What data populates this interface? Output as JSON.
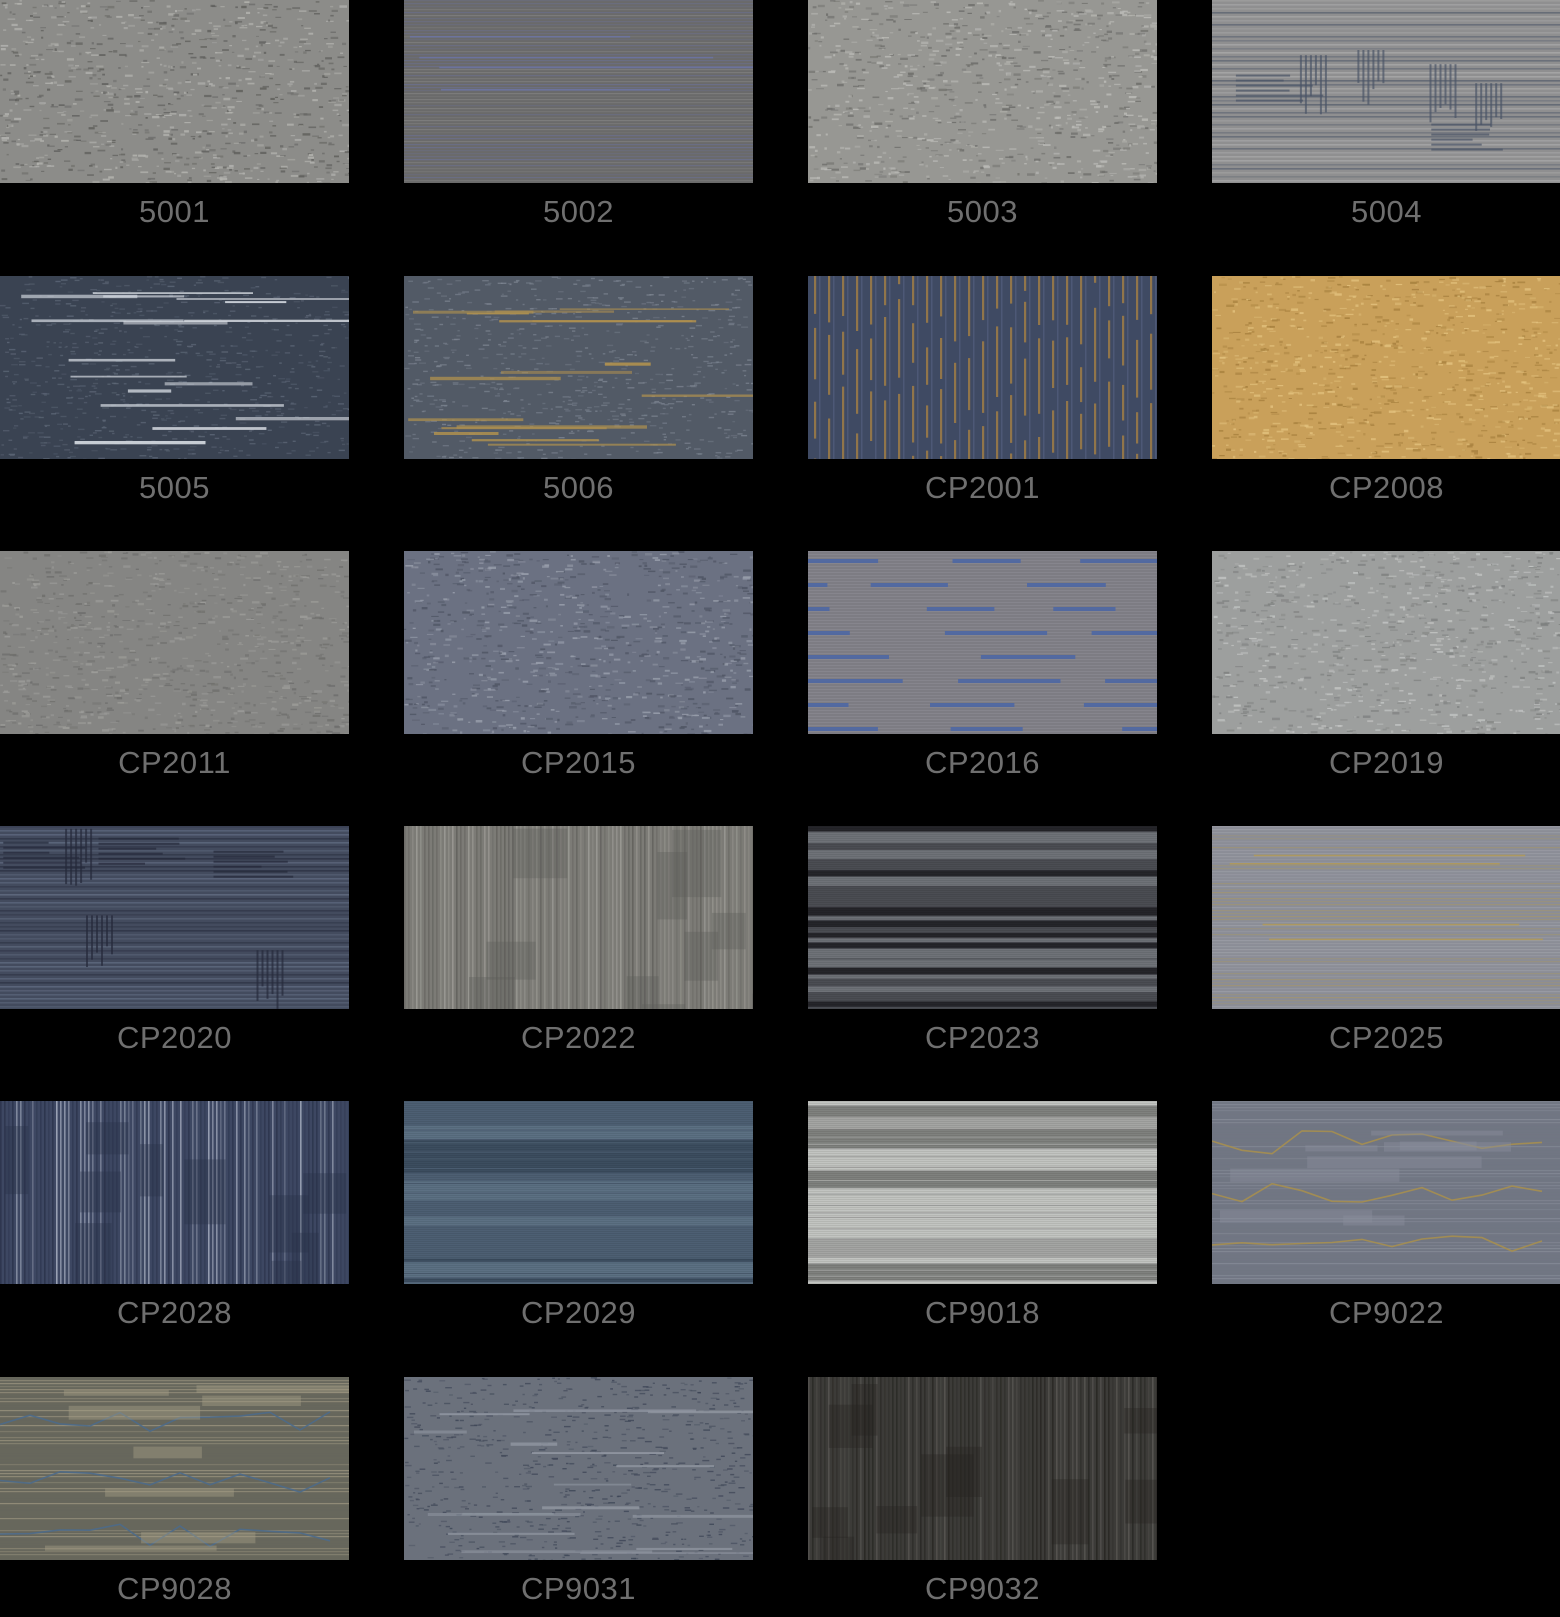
{
  "swatches": [
    {
      "code": "5001",
      "pattern": "noise",
      "base": "#8c8c89",
      "accent": "#b4b4b0",
      "accent2": "#5f5f5c"
    },
    {
      "code": "5002",
      "pattern": "hlines",
      "base": "#6a6a6a",
      "accent": "#8e8e8e",
      "accent2": "#6c74a4"
    },
    {
      "code": "5003",
      "pattern": "noise",
      "base": "#979793",
      "accent": "#bcbcb8",
      "accent2": "#6c6c69"
    },
    {
      "code": "5004",
      "pattern": "blocks",
      "base": "#8f8f90",
      "accent": "#b3b3b3",
      "accent2": "#4a5466"
    },
    {
      "code": "5005",
      "pattern": "streaks",
      "base": "#3a4352",
      "accent": "#d4d9e0",
      "accent2": "#5e6878"
    },
    {
      "code": "5006",
      "pattern": "streaks",
      "base": "#525a66",
      "accent": "#b0914f",
      "accent2": "#7d8592"
    },
    {
      "code": "CP2001",
      "pattern": "vdash",
      "base": "#3f4a63",
      "accent": "#a07c45",
      "accent2": "#566383"
    },
    {
      "code": "CP2008",
      "pattern": "noise",
      "base": "#c9a05a",
      "accent": "#e3c27e",
      "accent2": "#a67f3d"
    },
    {
      "code": "CP2011",
      "pattern": "noise",
      "base": "#858583",
      "accent": "#9d9d9a",
      "accent2": "#6e6e6c"
    },
    {
      "code": "CP2015",
      "pattern": "noise",
      "base": "#6b7182",
      "accent": "#9aa0ad",
      "accent2": "#4f5564"
    },
    {
      "code": "CP2016",
      "pattern": "dashes",
      "base": "#7d7c83",
      "accent": "#4e67a3",
      "accent2": "#9897a0"
    },
    {
      "code": "CP2019",
      "pattern": "noise",
      "base": "#9d9f9e",
      "accent": "#c3c5c4",
      "accent2": "#7e807f"
    },
    {
      "code": "CP2020",
      "pattern": "blocks",
      "base": "#434b5e",
      "accent": "#6e7a91",
      "accent2": "#25293a"
    },
    {
      "code": "CP2022",
      "pattern": "vlines",
      "base": "#7c7b76",
      "accent": "#a3a29c",
      "accent2": "#5d5c58"
    },
    {
      "code": "CP2023",
      "pattern": "hbands",
      "base": "#4b4d53",
      "accent": "#76797f",
      "accent2": "#1e1f23"
    },
    {
      "code": "CP2025",
      "pattern": "hlines",
      "base": "#8b8d96",
      "accent": "#a8aab2",
      "accent2": "#b19a57"
    },
    {
      "code": "CP2028",
      "pattern": "vlines",
      "base": "#3d4762",
      "accent": "#b9c0d0",
      "accent2": "#283048"
    },
    {
      "code": "CP2029",
      "pattern": "hbands",
      "base": "#4d5f73",
      "accent": "#5f7386",
      "accent2": "#3a4a5c"
    },
    {
      "code": "CP9018",
      "pattern": "hbands",
      "base": "#a4a5a3",
      "accent": "#c8c9c7",
      "accent2": "#797a78"
    },
    {
      "code": "CP9022",
      "pattern": "waves",
      "base": "#717683",
      "accent": "#8a8f9b",
      "accent2": "#a68f4f"
    },
    {
      "code": "CP9028",
      "pattern": "waves",
      "base": "#67675c",
      "accent": "#a59d86",
      "accent2": "#4d6a8a"
    },
    {
      "code": "CP9031",
      "pattern": "streaks",
      "base": "#6b717c",
      "accent": "#8f95a0",
      "accent2": "#3c4455"
    },
    {
      "code": "CP9032",
      "pattern": "vlines",
      "base": "#3c3b38",
      "accent": "#5e5c58",
      "accent2": "#24231f"
    }
  ]
}
